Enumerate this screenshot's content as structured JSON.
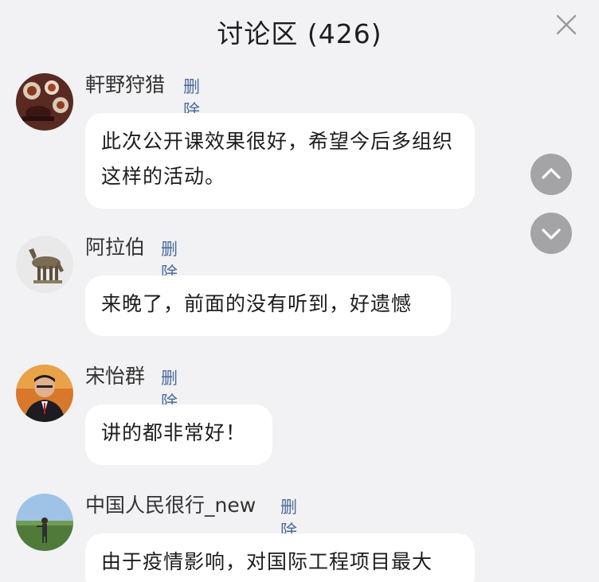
{
  "header": {
    "title": "讨论区 (426)"
  },
  "icons": {
    "close": "close-icon",
    "scroll_up": "chevron-up-icon",
    "scroll_down": "chevron-down-icon"
  },
  "comments": [
    {
      "username": "軒野狩猎",
      "delete_label": "删除",
      "text": "此次公开课效果很好，希望今后多组织这样的活动。"
    },
    {
      "username": "阿拉伯",
      "delete_label": "删除",
      "text": "来晚了，前面的没有听到，好遗憾"
    },
    {
      "username": "宋怡群",
      "delete_label": "删除",
      "text": "讲的都非常好！"
    },
    {
      "username": "中国人民很行_new",
      "delete_label": "删除",
      "text": "由于疫情影响，对国际工程项目最大"
    }
  ],
  "colors": {
    "background": "#f2f2f4",
    "bubble": "#ffffff",
    "delete_link": "#4a6b9a",
    "scroll_button": "#a4a4a7"
  }
}
